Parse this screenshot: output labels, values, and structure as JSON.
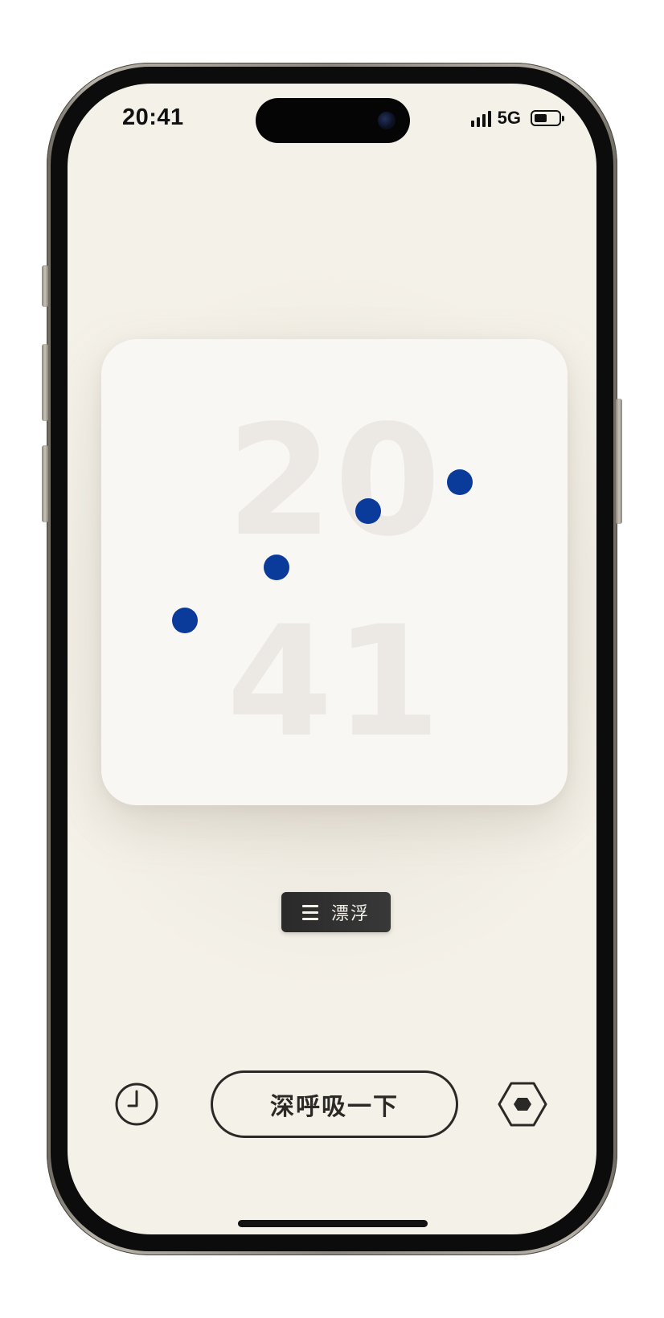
{
  "status_bar": {
    "time": "20:41",
    "network": "5G",
    "signal_icon": "signal-bars-icon",
    "battery_icon": "battery-icon",
    "battery_level": 0.55
  },
  "clock": {
    "hours": "20",
    "minutes": "41",
    "dot_color": "#0a3a9a",
    "digit_color": "#ece8e3"
  },
  "mode_button": {
    "icon": "menu-icon",
    "label": "漂浮"
  },
  "bottom_bar": {
    "history_icon": "clock-icon",
    "breathe_label": "深呼吸一下",
    "settings_icon": "hexagon-settings-icon"
  },
  "colors": {
    "background": "#f4f1e9",
    "card": "#f8f7f3",
    "ink": "#2b2926",
    "accent": "#0a3a9a"
  }
}
